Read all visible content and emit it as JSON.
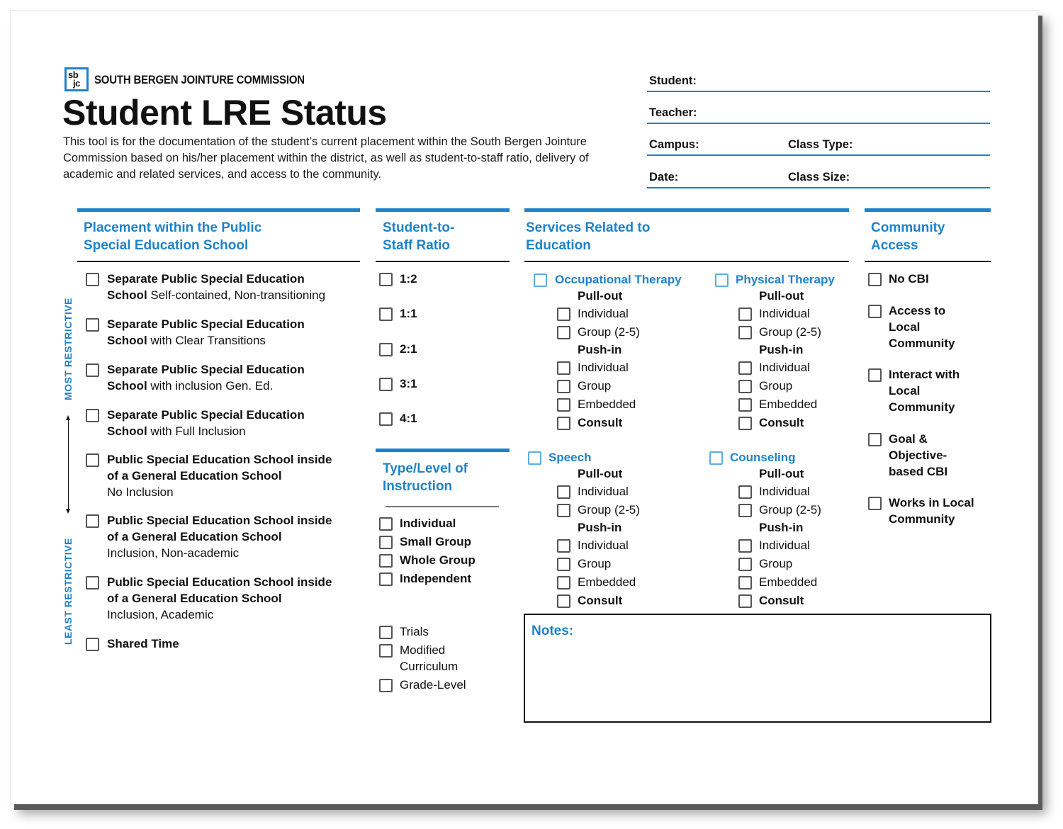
{
  "header": {
    "logo_text_top": "sb",
    "logo_text_bottom": "jc",
    "org_name": "SOUTH BERGEN JOINTURE COMMISSION",
    "title": "Student LRE Status",
    "intro": "This tool is for the documentation of the student’s current placement within the South Bergen Jointure Commission based on his/her placement within the district, as well as student-to-staff ratio, delivery of academic and related services, and access to the community."
  },
  "fields": {
    "student": "Student:",
    "teacher": "Teacher:",
    "campus": "Campus:",
    "class_type": "Class Type:",
    "date": "Date:",
    "class_size": "Class Size:"
  },
  "colors": {
    "accent": "#1f82c8",
    "checkbox_border": "#555555",
    "text": "#111111"
  },
  "placement": {
    "title_line1": "Placement within the Public",
    "title_line2": "Special Education School",
    "scale_most": "MOST  RESTRICTIVE",
    "scale_least": "LEAST  RESTRICTIVE",
    "items": [
      {
        "bold1": "Separate Public Special Education",
        "bold2": "School",
        "normal": " Self-contained, Non-transitioning"
      },
      {
        "bold1": "Separate Public Special Education",
        "bold2": "School",
        "normal": " with Clear Transitions"
      },
      {
        "bold1": "Separate Public Special Education",
        "bold2": "School",
        "normal": " with inclusion Gen. Ed."
      },
      {
        "bold1": "Separate Public Special Education",
        "bold2": "School",
        "normal": " with Full Inclusion"
      },
      {
        "bold1": "Public Special Education School inside",
        "bold2": "of a General Education School",
        "normal": "No Inclusion"
      },
      {
        "bold1": "Public Special Education School inside",
        "bold2": "of a General Education School",
        "normal": "Inclusion, Non-academic"
      },
      {
        "bold1": "Public Special Education School inside",
        "bold2": "of a General Education School",
        "normal": "Inclusion, Academic"
      },
      {
        "bold1": "Shared Time",
        "bold2": "",
        "normal": ""
      }
    ]
  },
  "ratio": {
    "title_line1": "Student-to-",
    "title_line2": "Staff Ratio",
    "items": [
      "1:2",
      "1:1",
      "2:1",
      "3:1",
      "4:1"
    ]
  },
  "instruction": {
    "title_line1": "Type/Level of",
    "title_line2": "Instruction",
    "type_items": [
      "Individual",
      "Small Group",
      "Whole Group",
      "Independent"
    ],
    "level_items": [
      "Trials",
      "Modified",
      "Curriculum",
      "Grade-Level"
    ]
  },
  "services": {
    "title_line1": "Services Related to",
    "title_line2": "Education",
    "groups": [
      {
        "name": "Occupational Therapy"
      },
      {
        "name": "Physical Therapy"
      },
      {
        "name": "Speech"
      },
      {
        "name": "Counseling"
      }
    ],
    "pull_out": "Pull-out",
    "push_in": "Push-in",
    "individual": "Individual",
    "group_2_5": "Group (2-5)",
    "group": "Group",
    "embedded": "Embedded",
    "consult": "Consult"
  },
  "community": {
    "title_line1": "Community",
    "title_line2": "Access",
    "items": [
      [
        "No CBI"
      ],
      [
        "Access to",
        "Local",
        "Community"
      ],
      [
        "Interact with",
        "Local",
        "Community"
      ],
      [
        "Goal &",
        "Objective-",
        "based CBI"
      ],
      [
        "Works in Local",
        "Community"
      ]
    ]
  },
  "notes": {
    "label": "Notes:"
  }
}
